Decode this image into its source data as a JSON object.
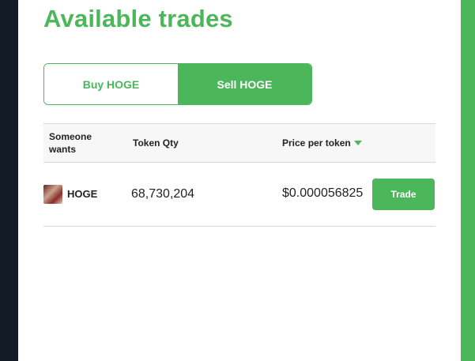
{
  "page": {
    "title": "Available trades"
  },
  "toggle": {
    "buy_label": "Buy HOGE",
    "sell_label": "Sell HOGE",
    "selected": "sell"
  },
  "table": {
    "headers": {
      "col1": "Someone wants",
      "col2": "Token Qty",
      "col3": "Price per token"
    },
    "sort_icon": "caret-down-icon",
    "rows": [
      {
        "token": "HOGE",
        "qty": "68,730,204",
        "price": "$0.000056825",
        "action_label": "Trade"
      }
    ]
  },
  "colors": {
    "accent": "#4cb65a",
    "left_rail": "#131b26",
    "text": "#222222"
  }
}
